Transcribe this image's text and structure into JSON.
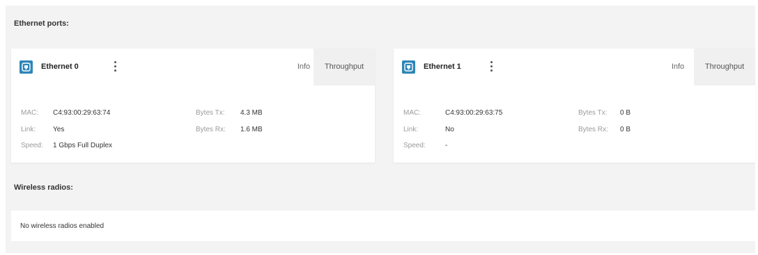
{
  "sections": {
    "ethernet_title": "Ethernet ports:",
    "wireless_title": "Wireless radios:"
  },
  "icons": {
    "port": "ethernet-port-icon",
    "menu": "more-vert-icon"
  },
  "colors": {
    "accent": "#2e86b8",
    "panel_bg": "#f3f3f3",
    "card_bg": "#ffffff",
    "active_tab_bg": "#f0f0f0",
    "label_color": "#9a9a9a"
  },
  "ethernet": [
    {
      "name": "Ethernet 0",
      "tabs": {
        "info": "Info",
        "throughput": "Throughput"
      },
      "mac_label": "MAC:",
      "mac": "C4:93:00:29:63:74",
      "link_label": "Link:",
      "link": "Yes",
      "speed_label": "Speed:",
      "speed": "1 Gbps Full Duplex",
      "tx_label": "Bytes Tx:",
      "tx": "4.3 MB",
      "rx_label": "Bytes Rx:",
      "rx": "1.6 MB"
    },
    {
      "name": "Ethernet 1",
      "tabs": {
        "info": "Info",
        "throughput": "Throughput"
      },
      "mac_label": "MAC:",
      "mac": "C4:93:00:29:63:75",
      "link_label": "Link:",
      "link": "No",
      "speed_label": "Speed:",
      "speed": "-",
      "tx_label": "Bytes Tx:",
      "tx": "0 B",
      "rx_label": "Bytes Rx:",
      "rx": "0 B"
    }
  ],
  "wireless": {
    "empty_message": "No wireless radios enabled"
  }
}
